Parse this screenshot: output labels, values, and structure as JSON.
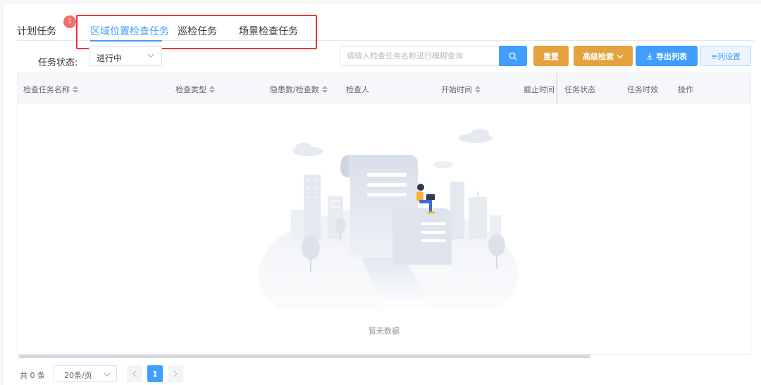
{
  "tabs": [
    {
      "label": "计划任务",
      "badge": "1"
    },
    {
      "label": "区域位置检查任务"
    },
    {
      "label": "巡检任务"
    },
    {
      "label": "场景检查任务"
    }
  ],
  "filter": {
    "status_label": "任务状态:",
    "status_value": "进行中",
    "search_placeholder": "请输入检查任务名称进行模糊查询"
  },
  "toolbar": {
    "reset": "重置",
    "advanced": "高级检索",
    "export": "导出列表",
    "columns": "≡列设置"
  },
  "table": {
    "columns": [
      "检查任务名称",
      "检查类型",
      "隐患数/检查数",
      "检查人",
      "开始时间",
      "截止时间",
      "任务状态",
      "任务时效",
      "操作"
    ],
    "empty_text": "暂无数据"
  },
  "pagination": {
    "total": "共 0 条",
    "page_size": "20条/页",
    "current_page": "1"
  },
  "colors": {
    "primary": "#409eff",
    "warning": "#e6a23c",
    "badge": "#f56c6c",
    "highlight_frame": "#e53935"
  }
}
